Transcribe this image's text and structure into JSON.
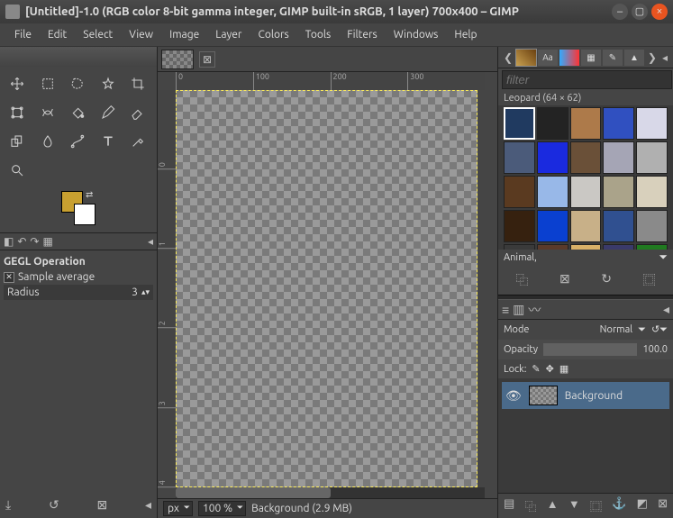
{
  "title": "[Untitled]-1.0 (RGB color 8-bit gamma integer, GIMP built-in sRGB, 1 layer) 700x400 – GIMP",
  "menu": [
    "File",
    "Edit",
    "Select",
    "View",
    "Image",
    "Layer",
    "Colors",
    "Tools",
    "Filters",
    "Windows",
    "Help"
  ],
  "ruler_h": [
    "0",
    "100",
    "200",
    "300"
  ],
  "ruler_v": [
    "0",
    "1",
    "2",
    "3",
    "4"
  ],
  "tool_options": {
    "title": "GEGL Operation",
    "sample_average": "Sample average",
    "radius_label": "Radius",
    "radius_value": 3
  },
  "swatches": {
    "fg": "#c8a030",
    "bg": "#ffffff"
  },
  "status": {
    "unit": "px",
    "zoom": "100 %",
    "info": "Background (2.9 MB)"
  },
  "patterns": {
    "filter_placeholder": "filter",
    "selected_name": "Leopard (64 × 62)",
    "category": "Animal,",
    "colors": [
      "#203a60",
      "#232323",
      "#ad7a4a",
      "#3050c0",
      "#d8d8e8",
      "#4b5b7a",
      "#1a2adf",
      "#6a5038",
      "#a5a5b5",
      "#b0b0b0",
      "#5a3a20",
      "#98b8e8",
      "#cac8c4",
      "#aaa38a",
      "#d8d0bc",
      "#36210f",
      "#0a40d0",
      "#c8b088",
      "#305090",
      "#8a8a8a",
      "#3a3a3a",
      "#5a3a2a",
      "#d8b068",
      "#3a3a6a",
      "#207a20"
    ]
  },
  "layers": {
    "mode_label": "Mode",
    "mode_value": "Normal",
    "opacity_label": "Opacity",
    "opacity_value": "100.0",
    "lock_label": "Lock:",
    "items": [
      {
        "name": "Background",
        "visible": true
      }
    ]
  }
}
